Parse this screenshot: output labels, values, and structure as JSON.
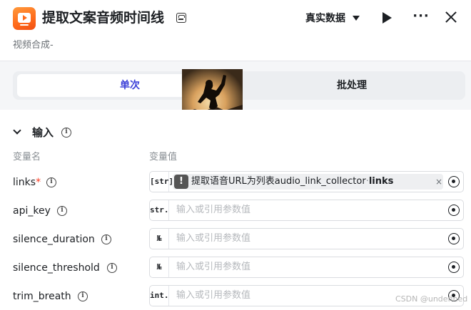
{
  "header": {
    "title": "提取文案音频时间线",
    "subtitle": "视频合成-",
    "data_mode": "真实数据",
    "more": "···"
  },
  "tabs": [
    {
      "label": "单次",
      "active": true
    },
    {
      "label": "批处理",
      "active": false
    }
  ],
  "input_section": {
    "title": "输入",
    "col_name": "变量名",
    "col_value": "变量值",
    "rows": [
      {
        "name": "links",
        "required": "*",
        "type": "[str]",
        "ref": {
          "source": "提取语音URL为列表audio_link_collector",
          "separator": "·",
          "variable": "links",
          "close": "×"
        }
      },
      {
        "name": "api_key",
        "type": "str.",
        "placeholder": "输入或引用参数值"
      },
      {
        "name": "silence_duration",
        "type": "№",
        "placeholder": "输入或引用参数值"
      },
      {
        "name": "silence_threshold",
        "type": "№",
        "placeholder": "输入或引用参数值"
      },
      {
        "name": "trim_breath",
        "type": "int.",
        "placeholder": "输入或引用参数值"
      }
    ]
  },
  "watermark": "CSDN @undefined",
  "colors": {
    "accent": "#3b3fd8",
    "app_icon": "#ff6a1a",
    "required": "#f93920"
  }
}
